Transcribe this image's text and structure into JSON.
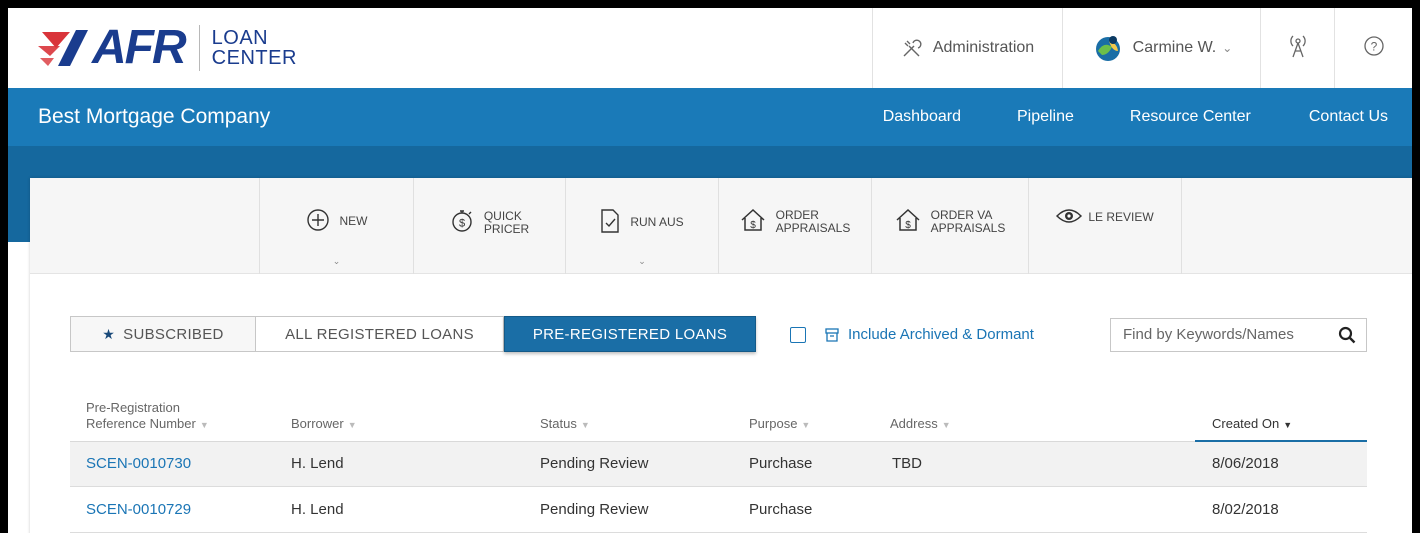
{
  "brand": {
    "logo_text": "AFR",
    "sub_line1": "LOAN",
    "sub_line2": "CENTER",
    "color": "#1a3c8e",
    "accent": "#d9343a"
  },
  "topbar": {
    "admin_label": "Administration",
    "user_label": "Carmine W.",
    "icons": [
      "tools-icon",
      "user-globe-icon",
      "broadcast-icon",
      "help-icon"
    ]
  },
  "nav": {
    "company": "Best Mortgage Company",
    "links": [
      "Dashboard",
      "Pipeline",
      "Resource Center",
      "Contact Us"
    ],
    "color": "#1a7ab8"
  },
  "toolbar": {
    "items": [
      {
        "label": "NEW",
        "icon": "plus-circle-icon"
      },
      {
        "label1": "QUICK",
        "label2": "PRICER",
        "icon": "dollar-stopwatch-icon"
      },
      {
        "label": "RUN AUS",
        "icon": "document-check-icon"
      },
      {
        "label1": "ORDER",
        "label2": "APPRAISALS",
        "icon": "house-dollar-icon"
      },
      {
        "label1": "ORDER VA",
        "label2": "APPRAISALS",
        "icon": "house-dollar-icon"
      },
      {
        "label": "LE REVIEW",
        "icon": "eye-icon"
      }
    ]
  },
  "tabs": {
    "subscribed": "SUBSCRIBED",
    "all_registered": "ALL REGISTERED LOANS",
    "pre_registered": "PRE-REGISTERED LOANS",
    "active": "pre_registered"
  },
  "filters": {
    "include_archived": "Include Archived & Dormant",
    "checked": false
  },
  "search": {
    "placeholder": "Find by Keywords/Names"
  },
  "table": {
    "headers": {
      "ref_line1": "Pre-Registration",
      "ref_line2": "Reference Number",
      "borrower": "Borrower",
      "status": "Status",
      "purpose": "Purpose",
      "address": "Address",
      "created": "Created On"
    },
    "sort_column": "created",
    "rows": [
      {
        "ref": "SCEN-0010730",
        "borrower": "H. Lend",
        "status": "Pending Review",
        "purpose": "Purchase",
        "address": "TBD",
        "created": "8/06/2018"
      },
      {
        "ref": "SCEN-0010729",
        "borrower": "H. Lend",
        "status": "Pending Review",
        "purpose": "Purchase",
        "address": "",
        "created": "8/02/2018"
      }
    ]
  }
}
